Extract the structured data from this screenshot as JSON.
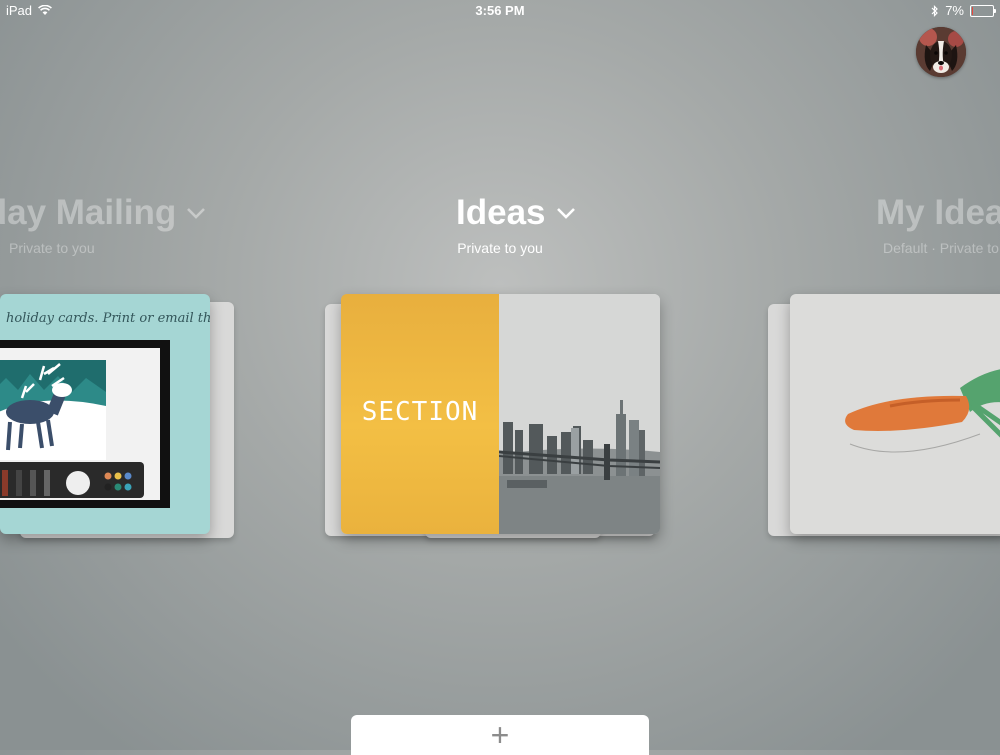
{
  "status_bar": {
    "device": "iPad",
    "time": "3:56 PM",
    "battery_percent": "7%",
    "battery_level": 0.07
  },
  "notebooks": [
    {
      "title": "iday Mailing",
      "subtitle": "Private to you"
    },
    {
      "title": "Ideas",
      "subtitle": "Private to you"
    },
    {
      "title": "My Idea",
      "subtitle": "Default · Private to y"
    }
  ],
  "left_page": {
    "handwriting": "holiday cards. Print or email them."
  },
  "center_page": {
    "section_label": "SECTION"
  },
  "bottom_bar": {
    "add_label": "+"
  }
}
